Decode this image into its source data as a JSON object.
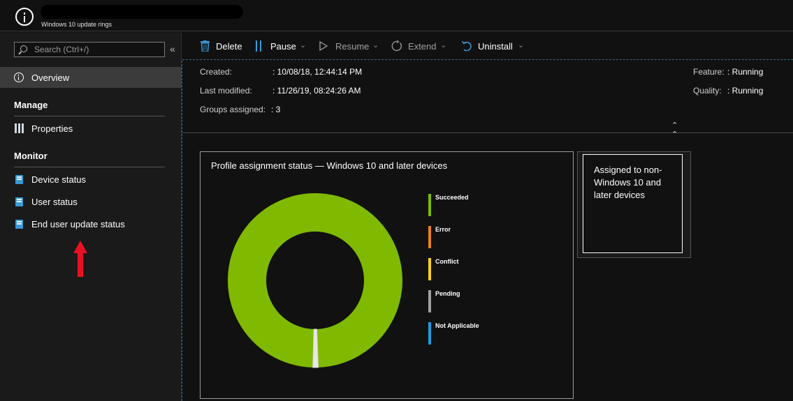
{
  "header": {
    "subtitle": "Windows 10 update rings"
  },
  "sidebar": {
    "search_placeholder": "Search (Ctrl+/)",
    "collapse_glyph": "«",
    "overview_label": "Overview",
    "manage_heading": "Manage",
    "manage_items": [
      {
        "label": "Properties",
        "icon": "properties-icon"
      }
    ],
    "monitor_heading": "Monitor",
    "monitor_items": [
      {
        "label": "Device status",
        "icon": "report-icon"
      },
      {
        "label": "User status",
        "icon": "report-icon"
      },
      {
        "label": "End user update status",
        "icon": "report-icon"
      }
    ]
  },
  "toolbar": {
    "delete_label": "Delete",
    "pause_label": "Pause",
    "resume_label": "Resume",
    "extend_label": "Extend",
    "uninstall_label": "Uninstall"
  },
  "essentials": {
    "created_label": "Created:",
    "created_value": ": 10/08/18, 12:44:14 PM",
    "modified_label": "Last modified:",
    "modified_value": ": 11/26/19, 08:24:26 AM",
    "groups_label": "Groups assigned:",
    "groups_value": ": 3",
    "feature_label": "Feature:",
    "feature_value": ": Running",
    "quality_label": "Quality:",
    "quality_value": ": Running"
  },
  "chart_data": {
    "type": "pie",
    "title": "Profile assignment status — Windows 10 and later devices",
    "categories": [
      "Succeeded",
      "Error",
      "Conflict",
      "Pending",
      "Not Applicable"
    ],
    "values": [
      99,
      0,
      0,
      1,
      0
    ],
    "colors": [
      "#7fba00",
      "#e8821e",
      "#fcd116",
      "#a0a0a0",
      "#1f9bde"
    ],
    "legend_position": "right"
  },
  "tile": {
    "text": "Assigned to non-Windows 10 and later devices"
  },
  "colors": {
    "background": "#111111",
    "sidebar": "#1a1a1a",
    "selected": "#3b3b3b",
    "accent_blue": "#3a9ad9",
    "arrow_red": "#e81123"
  }
}
